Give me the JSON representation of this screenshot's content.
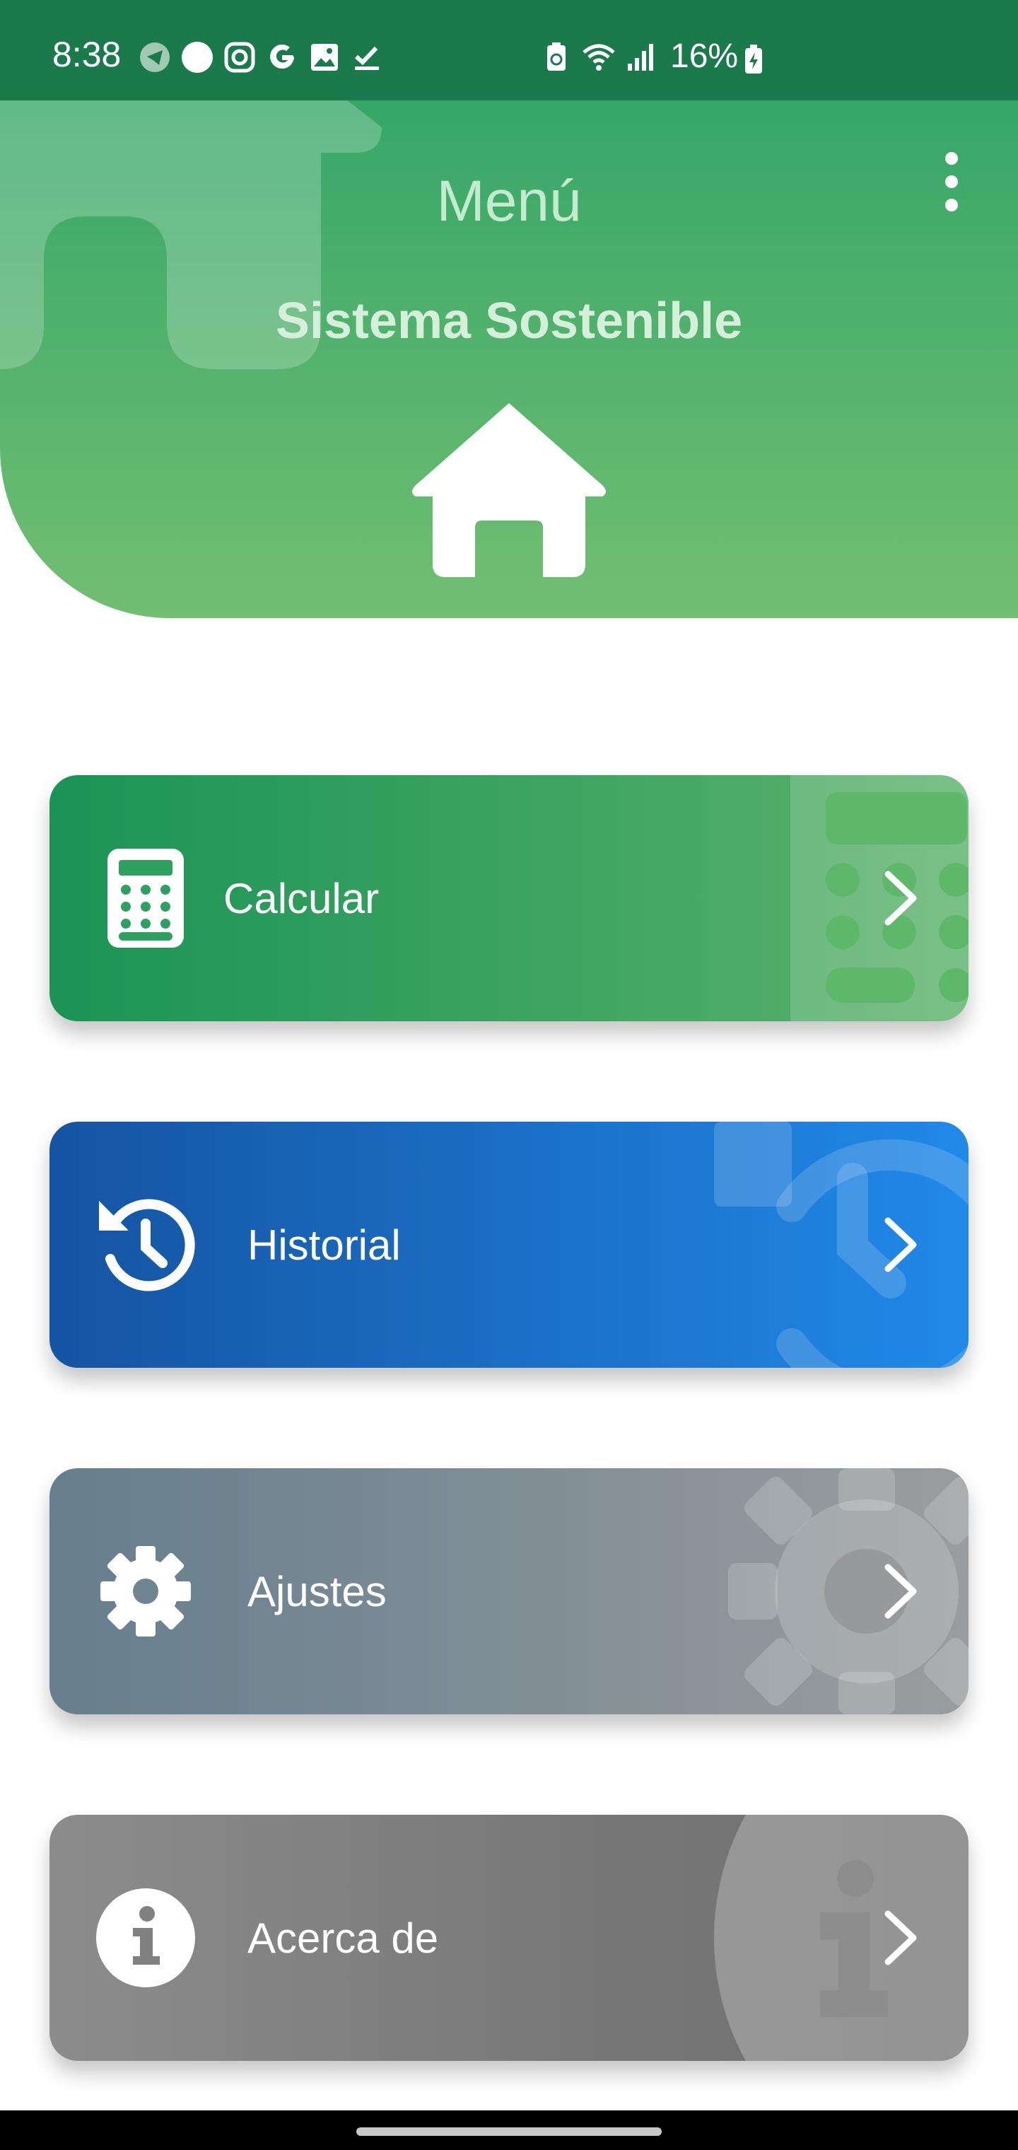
{
  "status_bar": {
    "time": "8:38",
    "left_icons": [
      "telegram-icon",
      "circle-dot-icon",
      "instagram-icon",
      "google-icon",
      "gallery-icon",
      "check-icon"
    ],
    "right_icons": [
      "battery-saver-icon",
      "wifi-icon",
      "signal-icon"
    ],
    "battery": "16%"
  },
  "header": {
    "title": "Menú",
    "subtitle": "Sistema Sostenible",
    "menu_icon": "kebab-icon",
    "hero_icon": "home-icon"
  },
  "menu": [
    {
      "label": "Calcular",
      "icon": "calculator-icon",
      "color_start": "#1a9455",
      "color_end": "#5cb26c"
    },
    {
      "label": "Historial",
      "icon": "history-icon",
      "color_start": "#1554a2",
      "color_end": "#2089e8"
    },
    {
      "label": "Ajustes",
      "icon": "gear-icon",
      "color_start": "#667e8d",
      "color_end": "#9a9d9f"
    },
    {
      "label": "Acerca de",
      "icon": "info-icon",
      "color_start": "#8c8c8c",
      "color_end": "#707070"
    }
  ],
  "colors": {
    "status_bar": "#1b7a4c",
    "header_top": "#2aa266",
    "header_bottom": "#72bf72"
  }
}
